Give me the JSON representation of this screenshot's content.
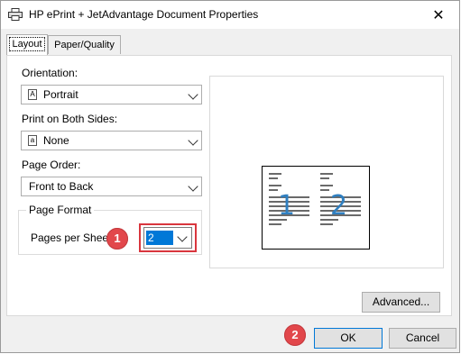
{
  "window": {
    "title": "HP ePrint + JetAdvantage Document Properties",
    "close_glyph": "✕"
  },
  "tabs": [
    {
      "label": "Layout",
      "active": true
    },
    {
      "label": "Paper/Quality",
      "active": false
    }
  ],
  "layout": {
    "orientation": {
      "label": "Orientation:",
      "value": "Portrait",
      "icon": "A"
    },
    "print_both_sides": {
      "label": "Print on Both Sides:",
      "value": "None",
      "icon": "a"
    },
    "page_order": {
      "label": "Page Order:",
      "value": "Front to Back"
    },
    "page_format": {
      "title": "Page Format",
      "pages_per_sheet_label": "Pages per Sheet",
      "pages_per_sheet_value": "2"
    }
  },
  "preview": {
    "page_numbers": [
      "1",
      "2"
    ]
  },
  "buttons": {
    "advanced": "Advanced...",
    "ok": "OK",
    "cancel": "Cancel"
  },
  "annotations": {
    "badge_1": "1",
    "badge_2": "2",
    "highlight_color": "#d9363e"
  },
  "colors": {
    "selection": "#0078d7",
    "page_number": "#2f7fc0"
  }
}
